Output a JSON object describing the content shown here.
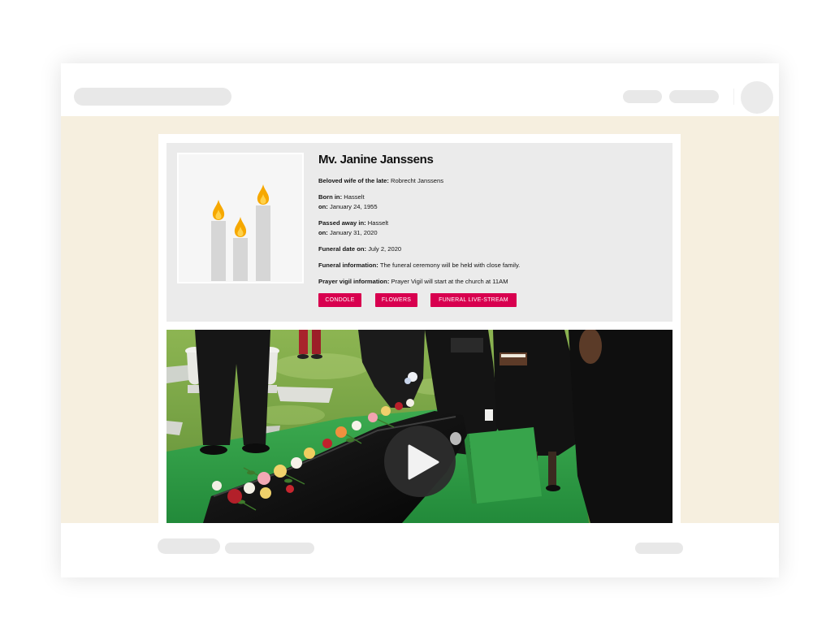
{
  "colors": {
    "page_background": "#ffffff",
    "content_background": "#f6efdf",
    "panel_background": "#ebebeb",
    "placeholder": "#e8e8e8",
    "accent": "#d8004f",
    "candle": "#d6d6d6",
    "flame": "#f6a800",
    "play_button": "#2d2d2d"
  },
  "icons": {
    "portrait": "candles-icon",
    "video": "play-icon",
    "header_user": "avatar-placeholder"
  },
  "obituary": {
    "name": "Mv. Janine Janssens",
    "details": {
      "spouse": {
        "label": "Beloved wife of the late:",
        "value": "Robrecht Janssens"
      },
      "born_place": {
        "label": "Born in:",
        "value": "Hasselt"
      },
      "born_date": {
        "label": "on:",
        "value": "January 24, 1955"
      },
      "died_place": {
        "label": "Passed away in:",
        "value": "Hasselt"
      },
      "died_date": {
        "label": "on:",
        "value": "January 31, 2020"
      },
      "funeral_date": {
        "label": "Funeral date on:",
        "value": "July 2, 2020"
      },
      "funeral_info": {
        "label": "Funeral information:",
        "value": "The funeral ceremony will be held with close family."
      },
      "vigil_info": {
        "label": "Prayer vigil information:",
        "value": "Prayer Vigil will start at the church at 11AM"
      }
    },
    "buttons": {
      "condole": "CONDOLE",
      "flowers": "FLOWERS",
      "livestream": "FUNERAL LIVE-STREAM"
    }
  }
}
